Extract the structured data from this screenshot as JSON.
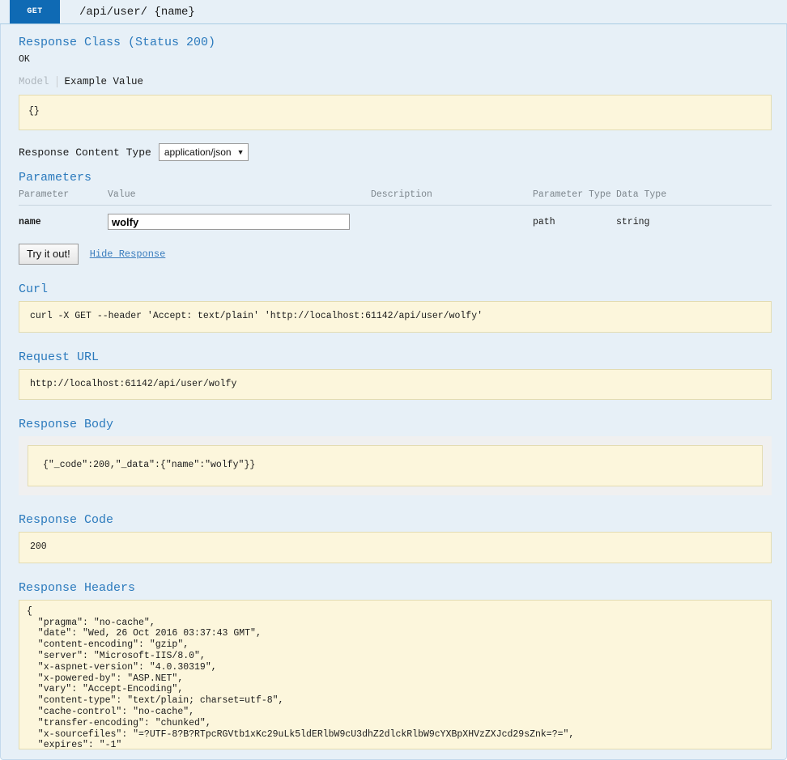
{
  "operation": {
    "method": "GET",
    "path": "/api/user/ {name}"
  },
  "response_class": {
    "heading": "Response Class (Status 200)",
    "status_text": "OK",
    "tabs": [
      {
        "label": "Model",
        "active": false
      },
      {
        "label": "Example Value",
        "active": true
      }
    ],
    "example_value": "{}"
  },
  "content_type": {
    "label": "Response Content Type",
    "selected": "application/json",
    "caret_icon": "chevron-down-icon"
  },
  "parameters": {
    "heading": "Parameters",
    "columns": [
      "Parameter",
      "Value",
      "Description",
      "Parameter Type",
      "Data Type"
    ],
    "rows": [
      {
        "name": "name",
        "value": "wolfy",
        "description": "",
        "parameter_type": "path",
        "data_type": "string"
      }
    ]
  },
  "actions": {
    "submit_label": "Try it out!",
    "hide_response_label": "Hide Response"
  },
  "curl": {
    "heading": "Curl",
    "command": "curl -X GET --header 'Accept: text/plain' 'http://localhost:61142/api/user/wolfy'"
  },
  "request_url": {
    "heading": "Request URL",
    "url": "http://localhost:61142/api/user/wolfy"
  },
  "response_body": {
    "heading": "Response Body",
    "body": "{\"_code\":200,\"_data\":{\"name\":\"wolfy\"}}"
  },
  "response_code": {
    "heading": "Response Code",
    "code": "200"
  },
  "response_headers": {
    "heading": "Response Headers",
    "json": "{\n  \"pragma\": \"no-cache\",\n  \"date\": \"Wed, 26 Oct 2016 03:37:43 GMT\",\n  \"content-encoding\": \"gzip\",\n  \"server\": \"Microsoft-IIS/8.0\",\n  \"x-aspnet-version\": \"4.0.30319\",\n  \"x-powered-by\": \"ASP.NET\",\n  \"vary\": \"Accept-Encoding\",\n  \"content-type\": \"text/plain; charset=utf-8\",\n  \"cache-control\": \"no-cache\",\n  \"transfer-encoding\": \"chunked\",\n  \"x-sourcefiles\": \"=?UTF-8?B?RTpcRGVtb1xKc29uLk5ldERlbW9cU3dhZ2dlckRlbW9cYXBpXHVzZXJcd29sZnk=?=\",\n  \"expires\": \"-1\"\n}"
  },
  "colors": {
    "method_badge": "#0f6ab4",
    "panel_background": "#e7f0f7",
    "code_background": "#fcf6dc",
    "heading_blue": "#2b7abd"
  }
}
